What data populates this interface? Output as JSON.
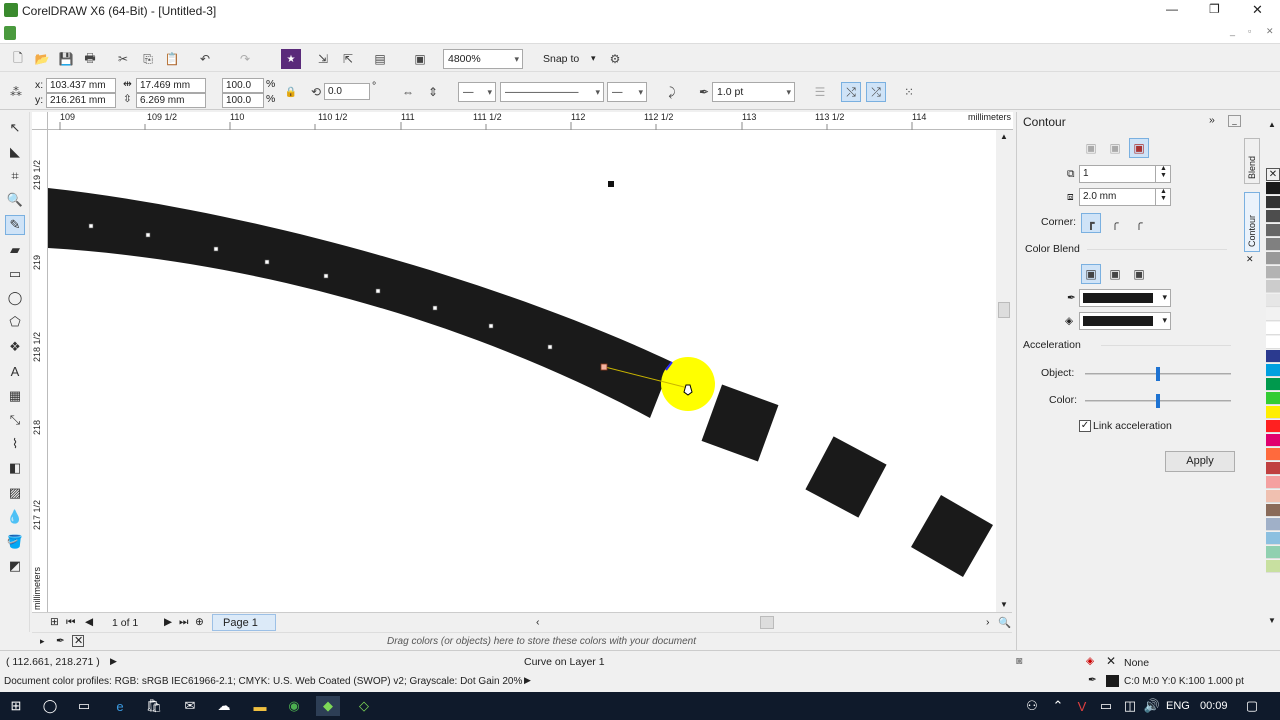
{
  "window": {
    "title": "CorelDRAW X6 (64-Bit) - [Untitled-3]",
    "minimize": "—",
    "restore": "❐",
    "close": "✕"
  },
  "toolbar": {
    "zoom": "4800%",
    "snap_to": "Snap to"
  },
  "properties": {
    "x": "103.437 mm",
    "y": "216.261 mm",
    "width": "17.469 mm",
    "height": "6.269 mm",
    "scale_x": "100.0",
    "scale_y": "100.0",
    "percent": "%",
    "rotation": "0.0",
    "degree": "°",
    "outline_width": "1.0 pt",
    "x_label": "x:",
    "y_label": "y:"
  },
  "ruler": {
    "h_ticks": [
      "109",
      "109 1/2",
      "110",
      "110 1/2",
      "111",
      "111 1/2",
      "112",
      "112 1/2",
      "113",
      "113 1/2",
      "114"
    ],
    "h_unit": "millimeters",
    "v_ticks": [
      "219 1/2",
      "219",
      "218 1/2",
      "218",
      "217 1/2"
    ],
    "v_unit": "millimeters"
  },
  "page_nav": {
    "count": "1 of 1",
    "page_tab": "Page 1"
  },
  "palette_hint": "Drag colors (or objects) here to store these colors with your document",
  "docker": {
    "title": "Contour",
    "steps": "1",
    "offset": "2.0 mm",
    "corner_label": "Corner:",
    "color_blend_label": "Color Blend",
    "acceleration_label": "Acceleration",
    "object_label": "Object:",
    "color_label": "Color:",
    "object_accel": 0.5,
    "color_accel": 0.5,
    "link_label": "Link acceleration",
    "apply": "Apply",
    "tab_blend": "Blend",
    "tab_contour": "Contour"
  },
  "status": {
    "coords": "( 112.661, 218.271 )",
    "object": "Curve on Layer 1",
    "fill": "None",
    "profiles": "Document color profiles: RGB: sRGB IEC61966-2.1; CMYK: U.S. Web Coated (SWOP) v2; Grayscale: Dot Gain 20%",
    "outline": "C:0 M:0 Y:0 K:100  1.000 pt"
  },
  "taskbar": {
    "lang": "ENG",
    "time": "00:09"
  },
  "colors": {
    "accent": "#1e73d2",
    "shape": "#1a1a1a",
    "highlight": "#ffff00"
  }
}
